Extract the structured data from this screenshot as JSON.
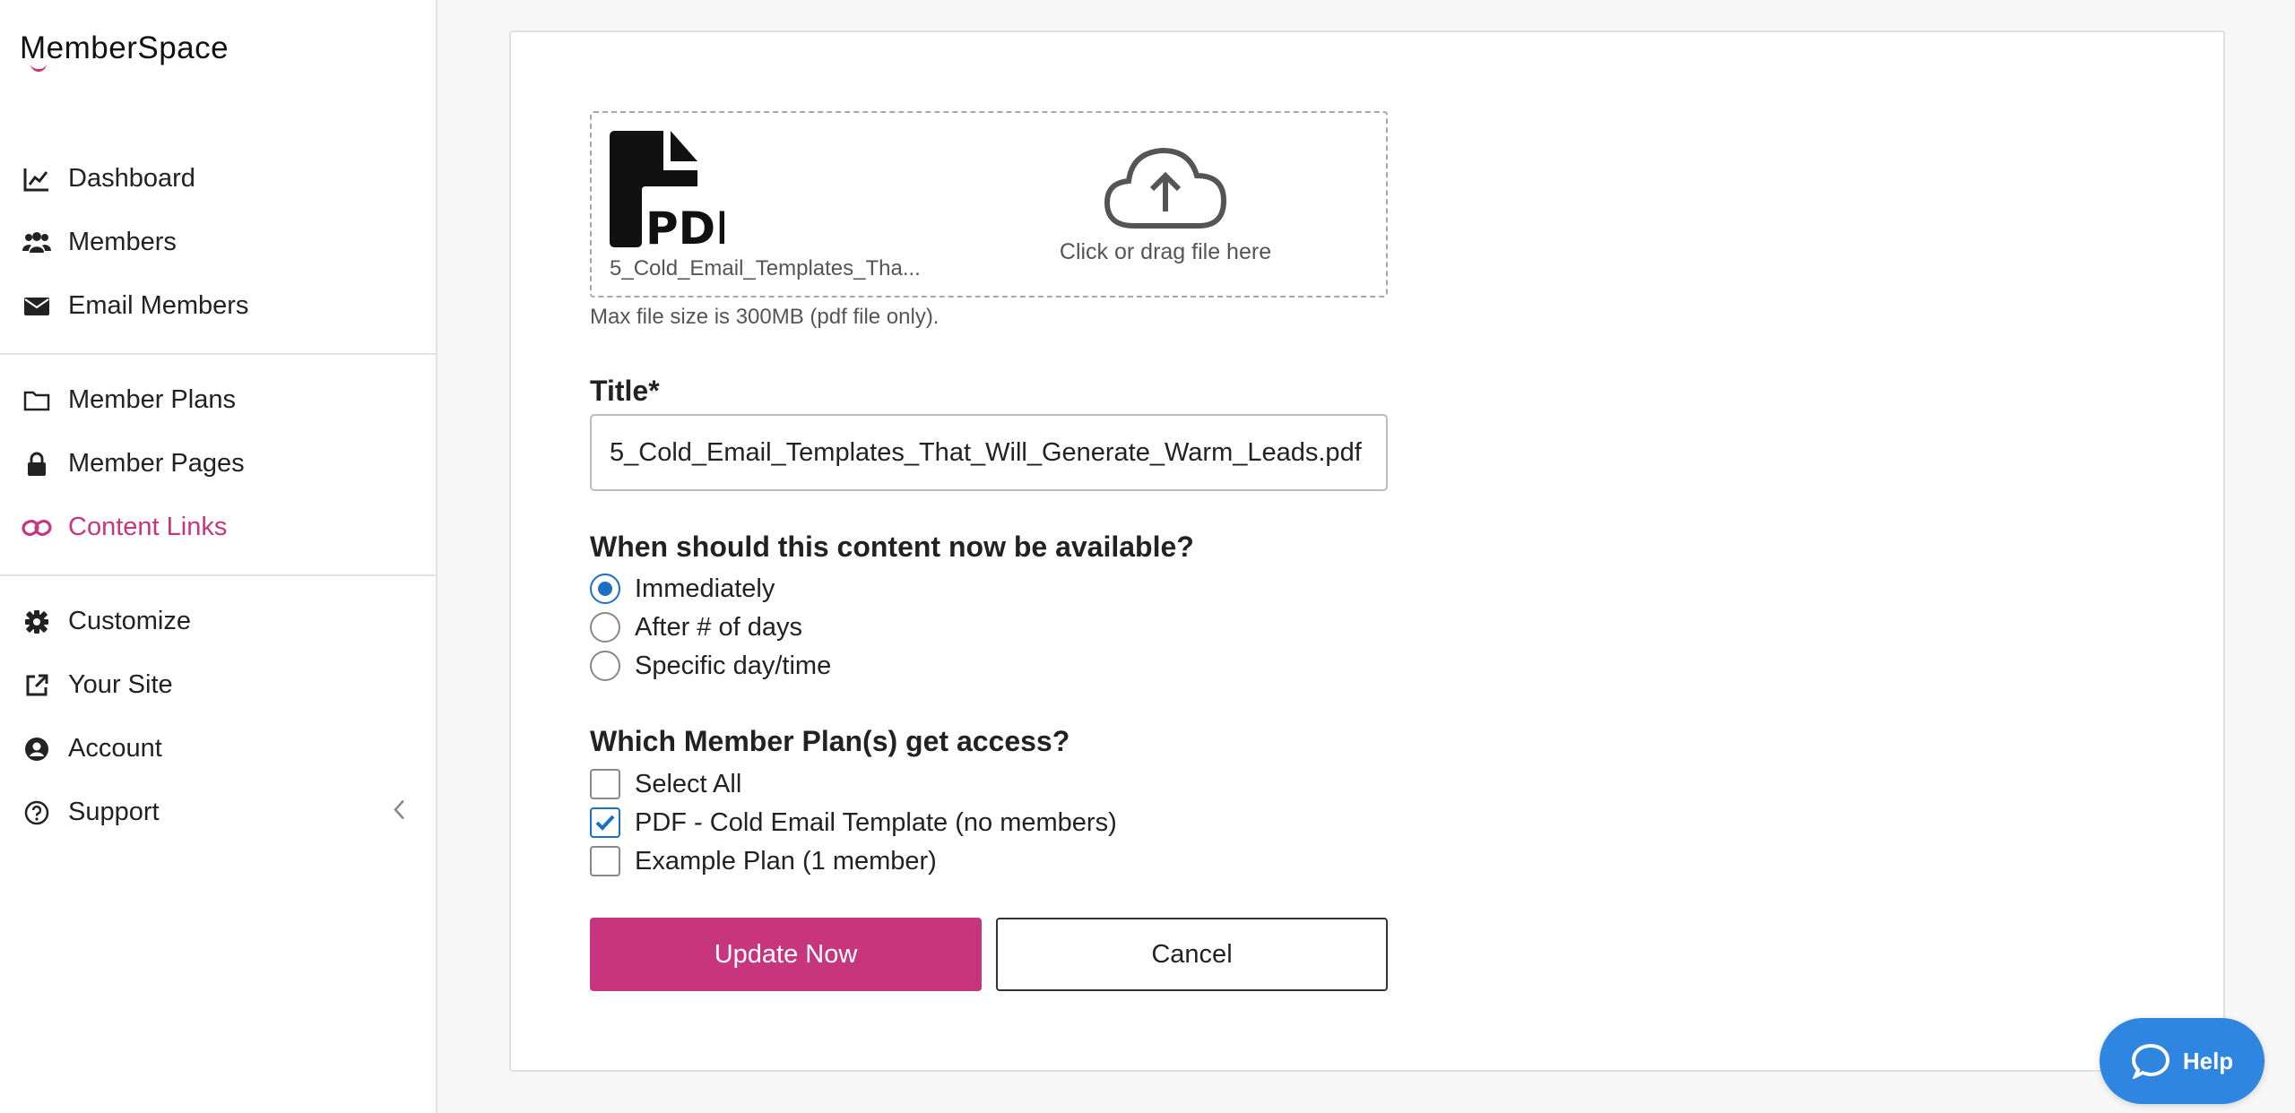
{
  "app": {
    "logo_text": "emberSpace",
    "logo_initial": "M"
  },
  "sidebar": {
    "items": [
      {
        "label": "Dashboard",
        "icon": "chart-line-icon"
      },
      {
        "label": "Members",
        "icon": "users-icon"
      },
      {
        "label": "Email Members",
        "icon": "envelope-icon"
      },
      {
        "label": "Member Plans",
        "icon": "folder-icon"
      },
      {
        "label": "Member Pages",
        "icon": "lock-icon"
      },
      {
        "label": "Content Links",
        "icon": "link-icon",
        "active": true
      },
      {
        "label": "Customize",
        "icon": "gear-icon"
      },
      {
        "label": "Your Site",
        "icon": "external-link-icon"
      },
      {
        "label": "Account",
        "icon": "user-circle-icon"
      },
      {
        "label": "Support",
        "icon": "question-circle-icon"
      }
    ]
  },
  "upload": {
    "file_name": "5_Cold_Email_Templates_Tha...",
    "prompt": "Click or drag file here",
    "hint": "Max file size is 300MB (pdf file only).",
    "pdf_label": "PDF"
  },
  "form": {
    "title_label": "Title*",
    "title_value": "5_Cold_Email_Templates_That_Will_Generate_Warm_Leads.pdf",
    "availability_label": "When should this content now be available?",
    "availability_options": [
      {
        "label": "Immediately",
        "checked": true
      },
      {
        "label": "After # of days",
        "checked": false
      },
      {
        "label": "Specific day/time",
        "checked": false
      }
    ],
    "plans_label": "Which Member Plan(s) get access?",
    "plan_options": [
      {
        "label": "Select All",
        "checked": false
      },
      {
        "label": "PDF - Cold Email Template (no members)",
        "checked": true
      },
      {
        "label": "Example Plan (1 member)",
        "checked": false
      }
    ],
    "update_label": "Update Now",
    "cancel_label": "Cancel"
  },
  "help": {
    "label": "Help"
  },
  "colors": {
    "accent": "#c8357f",
    "blue": "#1c6fc4",
    "help_blue": "#2f86e0"
  }
}
